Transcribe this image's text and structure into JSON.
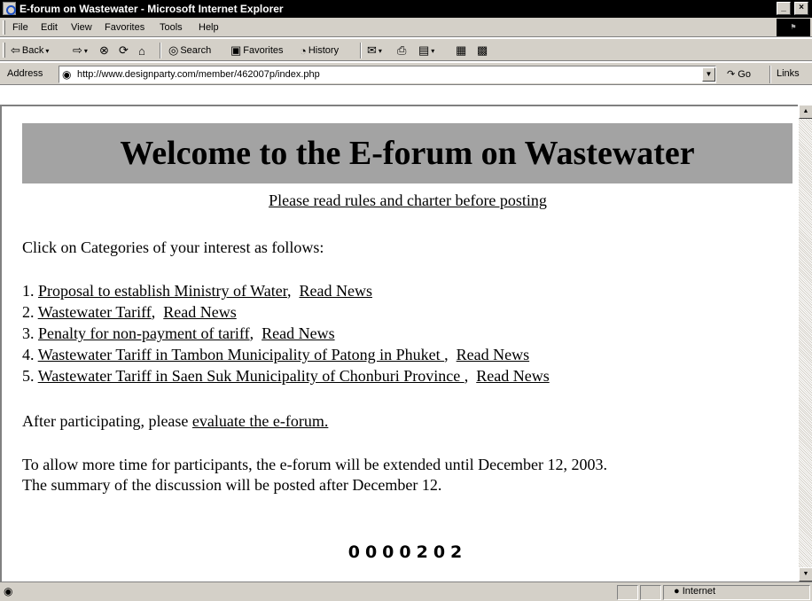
{
  "window": {
    "title": "E-forum on Wastewater - Microsoft Internet Explorer",
    "controls": [
      "_",
      "×"
    ]
  },
  "menu": {
    "file": "File",
    "edit": "Edit",
    "view": "View",
    "favorites": "Favorites",
    "tools": "Tools",
    "help": "Help"
  },
  "toolbar": {
    "back": "Back",
    "search": "Search",
    "favorites": "Favorites",
    "history": "History"
  },
  "address": {
    "label": "Address",
    "url": "http://www.designparty.com/member/462007p/index.php",
    "go": "Go",
    "links": "Links"
  },
  "page": {
    "heading": "Welcome to the E-forum on Wastewater",
    "rules_link": "Please read rules and charter before posting",
    "intro": "Click on Categories of your interest as follows:",
    "categories": [
      {
        "num": "1.",
        "topic": "Proposal to establish Ministry of Water",
        "sep": ",",
        "news": "Read News"
      },
      {
        "num": "2.",
        "topic": "Wastewater Tariff",
        "sep": ",",
        "news": "Read News"
      },
      {
        "num": "3.",
        "topic": "Penalty for non-payment of tariff",
        "sep": ",",
        "news": "Read News"
      },
      {
        "num": "4.",
        "topic": "Wastewater Tariff in Tambon Municipality of Patong in Phuket ",
        "sep": ",",
        "news": "Read News"
      },
      {
        "num": "5.",
        "topic": "Wastewater Tariff in Saen Suk Municipality of Chonburi Province ",
        "sep": ",",
        "news": "Read News"
      }
    ],
    "evaluate_prefix": "After participating, please",
    "evaluate_link": "evaluate the e-forum.",
    "notice_line1": "To allow more time for participants, the e-forum will be extended until December 12, 2003.",
    "notice_line2": "The summary of the discussion will be posted after December 12.",
    "hit_counter": "0000202"
  },
  "status": {
    "zone": "Internet"
  }
}
